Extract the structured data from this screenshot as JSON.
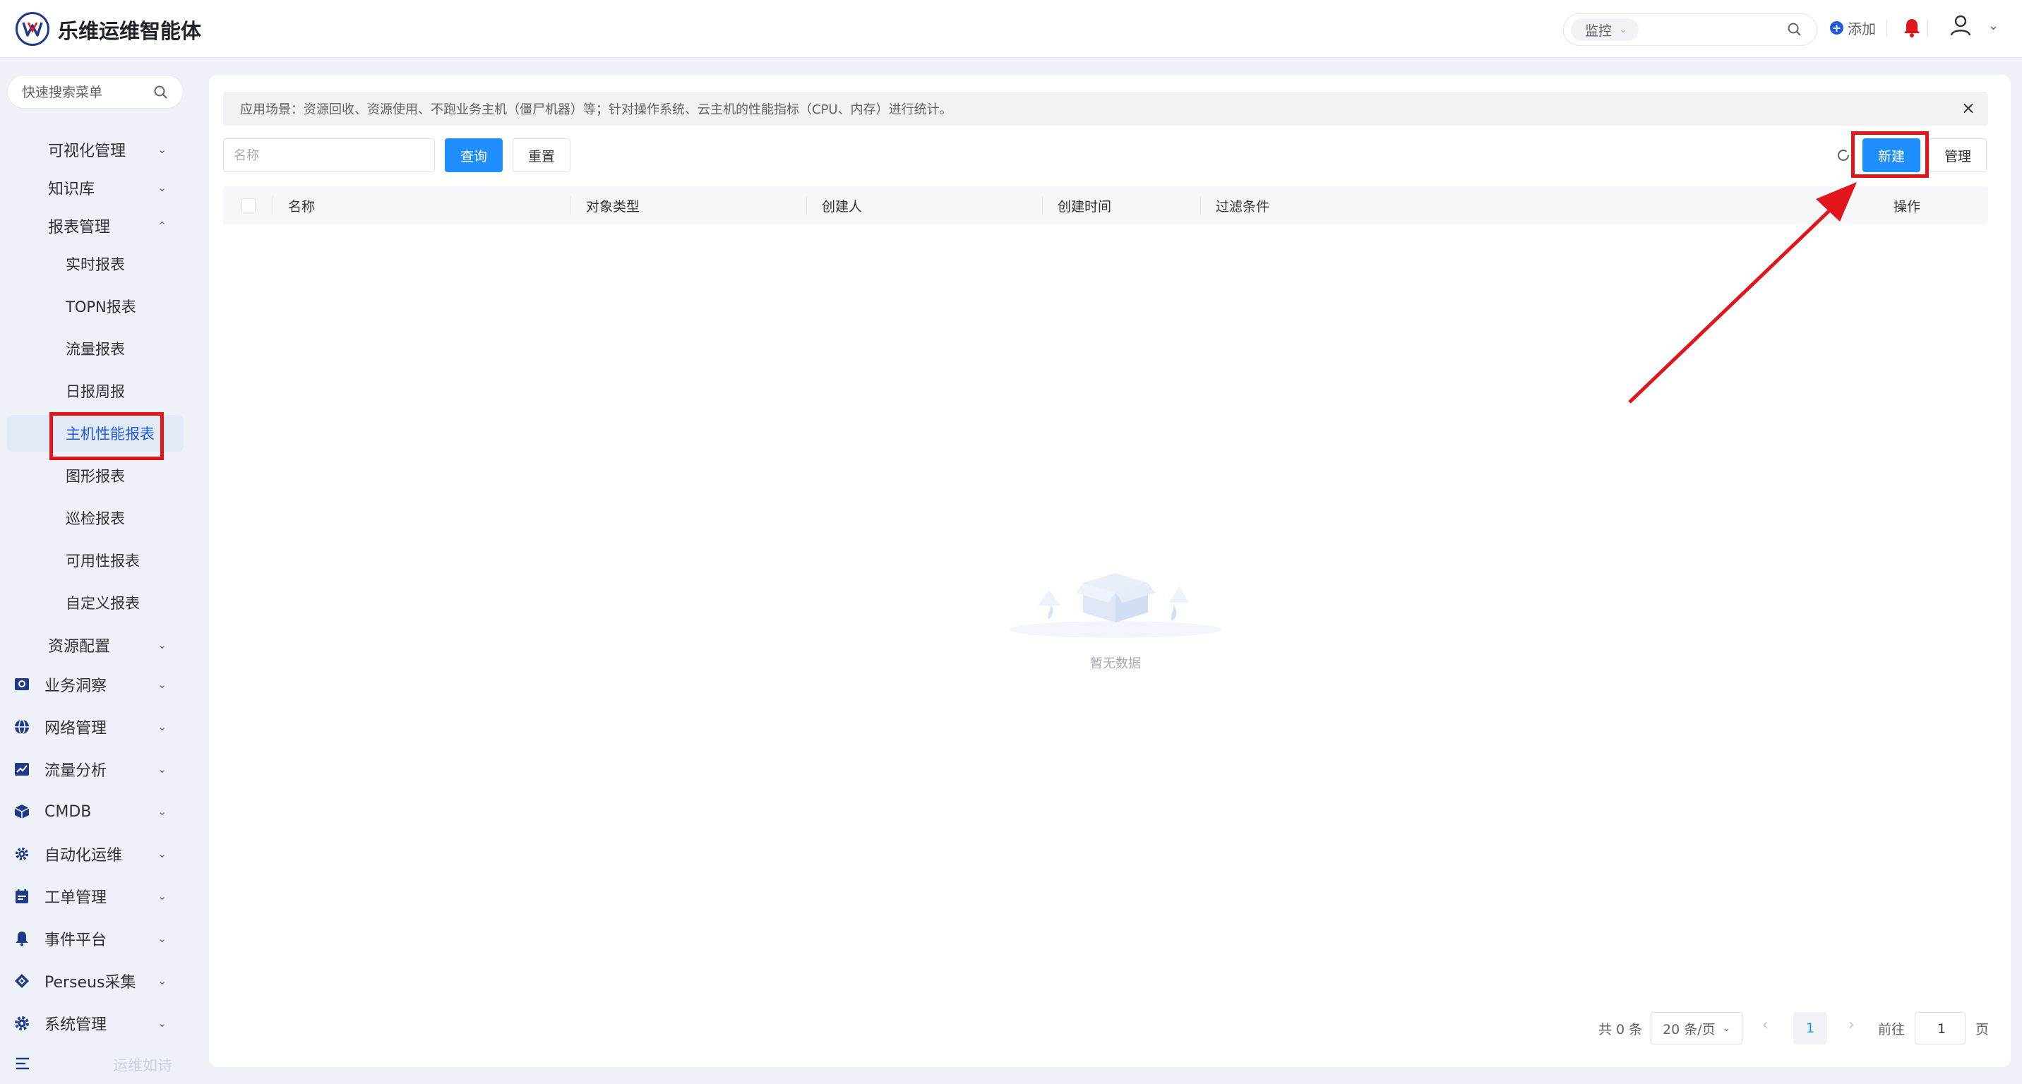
{
  "app": {
    "title": "乐维运维智能体"
  },
  "topbar": {
    "search_scope": "监控",
    "search_placeholder": "",
    "add_label": "添加"
  },
  "sidebar": {
    "search_placeholder": "快速搜索菜单",
    "items": [
      {
        "label": "可视化管理",
        "level": 2,
        "expanded": false
      },
      {
        "label": "知识库",
        "level": 2,
        "expanded": false
      },
      {
        "label": "报表管理",
        "level": 2,
        "expanded": true
      },
      {
        "label": "实时报表",
        "level": 3
      },
      {
        "label": "TOPN报表",
        "level": 3
      },
      {
        "label": "流量报表",
        "level": 3
      },
      {
        "label": "日报周报",
        "level": 3
      },
      {
        "label": "主机性能报表",
        "level": 3,
        "active": true
      },
      {
        "label": "图形报表",
        "level": 3
      },
      {
        "label": "巡检报表",
        "level": 3
      },
      {
        "label": "可用性报表",
        "level": 3
      },
      {
        "label": "自定义报表",
        "level": 3
      },
      {
        "label": "资源配置",
        "level": 2,
        "expanded": false
      },
      {
        "label": "业务洞察",
        "level": 1,
        "icon": "monitor-icon"
      },
      {
        "label": "网络管理",
        "level": 1,
        "icon": "globe-icon"
      },
      {
        "label": "流量分析",
        "level": 1,
        "icon": "line-chart-icon"
      },
      {
        "label": "CMDB",
        "level": 1,
        "icon": "cube-icon"
      },
      {
        "label": "自动化运维",
        "level": 1,
        "icon": "gear-icon"
      },
      {
        "label": "工单管理",
        "level": 1,
        "icon": "calendar-icon"
      },
      {
        "label": "事件平台",
        "level": 1,
        "icon": "bell-icon"
      },
      {
        "label": "Perseus采集",
        "level": 1,
        "icon": "diamond-icon"
      },
      {
        "label": "系统管理",
        "level": 1,
        "icon": "settings-icon"
      }
    ],
    "footer_text": "运维如诗"
  },
  "main": {
    "notice": "应用场景：资源回收、资源使用、不跑业务主机（僵尸机器）等；针对操作系统、云主机的性能指标（CPU、内存）进行统计。",
    "filter": {
      "name_placeholder": "名称",
      "query_label": "查询",
      "reset_label": "重置"
    },
    "actions": {
      "new_label": "新建",
      "manage_label": "管理"
    },
    "table": {
      "columns": [
        "名称",
        "对象类型",
        "创建人",
        "创建时间",
        "过滤条件",
        "操作"
      ],
      "rows": []
    },
    "empty_text": "暂无数据",
    "pagination": {
      "total": "共 0 条",
      "page_size": "20 条/页",
      "current_page": "1",
      "goto_label": "前往",
      "goto_value": "1",
      "goto_unit": "页"
    }
  },
  "colors": {
    "primary": "#1f8fff",
    "annotation": "#e0161c",
    "brand": "#1f3a8a"
  }
}
